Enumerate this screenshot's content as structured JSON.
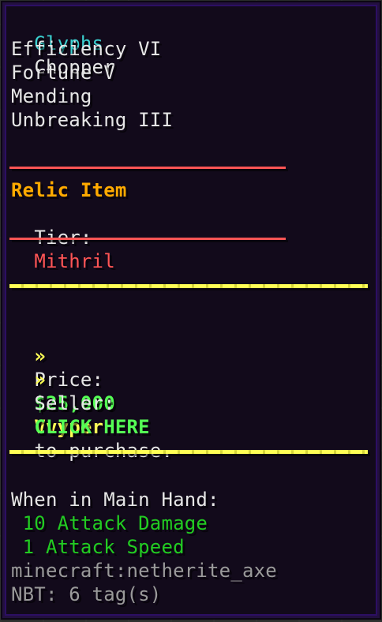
{
  "item": {
    "name_prefix": "Glyphs",
    "name_suffix": "Chopper",
    "enchantments": [
      "Efficiency VI",
      "Fortune V",
      "Mending",
      "Unbreaking III"
    ]
  },
  "relic": {
    "title": "Relic Item",
    "tier_label": "Tier:",
    "tier_value": "Mithril"
  },
  "sale": {
    "price_label": "Price:",
    "price_value": "$25,000",
    "seller_label": "Seller:",
    "seller_value": "Vvyper",
    "bullet": "»",
    "click_label": "CLICK HERE",
    "click_suffix": "to purchase."
  },
  "attributes": {
    "header": "When in Main Hand:",
    "lines": [
      "10 Attack Damage",
      "1 Attack Speed"
    ]
  },
  "meta": {
    "item_id": "minecraft:netherite_axe",
    "nbt": "NBT: 6 tag(s)"
  },
  "colors": {
    "aqua": "#3bd0d0",
    "gold": "#ffaa00",
    "red": "#ff5555",
    "green": "#55ff55",
    "yellow": "#ffff55",
    "dark_green": "#22cc22",
    "gray": "#9a9a9a"
  }
}
